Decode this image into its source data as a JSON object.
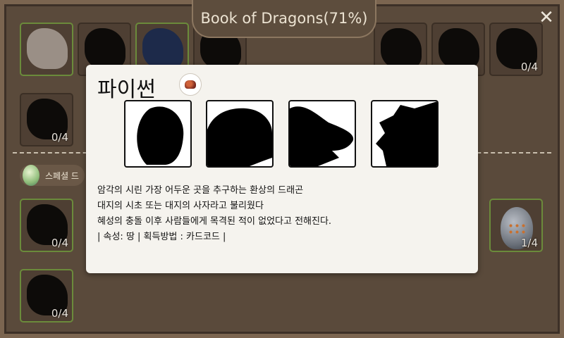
{
  "header": {
    "title": "Book of Dragons(71%)",
    "close_glyph": "✕"
  },
  "grid": {
    "row1_counts": [
      "",
      "",
      "",
      "",
      "",
      "",
      "",
      "",
      "",
      "0/4"
    ],
    "row2_counts": [
      "0/4"
    ],
    "section_label": "스페셜 드",
    "row3_counts": [
      "0/4",
      "",
      "",
      "",
      "",
      "",
      "",
      "",
      "",
      "1/4"
    ],
    "row4_counts": [
      "0/4"
    ]
  },
  "modal": {
    "dragon_name": "파이썬",
    "element_icon": "earth-element-icon",
    "stage_icons": [
      "stage-1-silhouette-icon",
      "stage-2-silhouette-icon",
      "stage-3-silhouette-icon",
      "stage-4-silhouette-icon"
    ],
    "description_lines": [
      "암각의 시린 가장 어두운 곳을 추구하는 환상의 드래곤",
      "대지의 시초 또는 대지의 사자라고 불리웠다",
      "혜성의 충돌 이후 사람들에게 목격된 적이 없었다고 전해진다.",
      "| 속성: 땅 | 획득방법 : 카드코드 |"
    ]
  },
  "colors": {
    "owned_border": "#6b8b3b",
    "modal_bg": "#f5f3ee"
  }
}
